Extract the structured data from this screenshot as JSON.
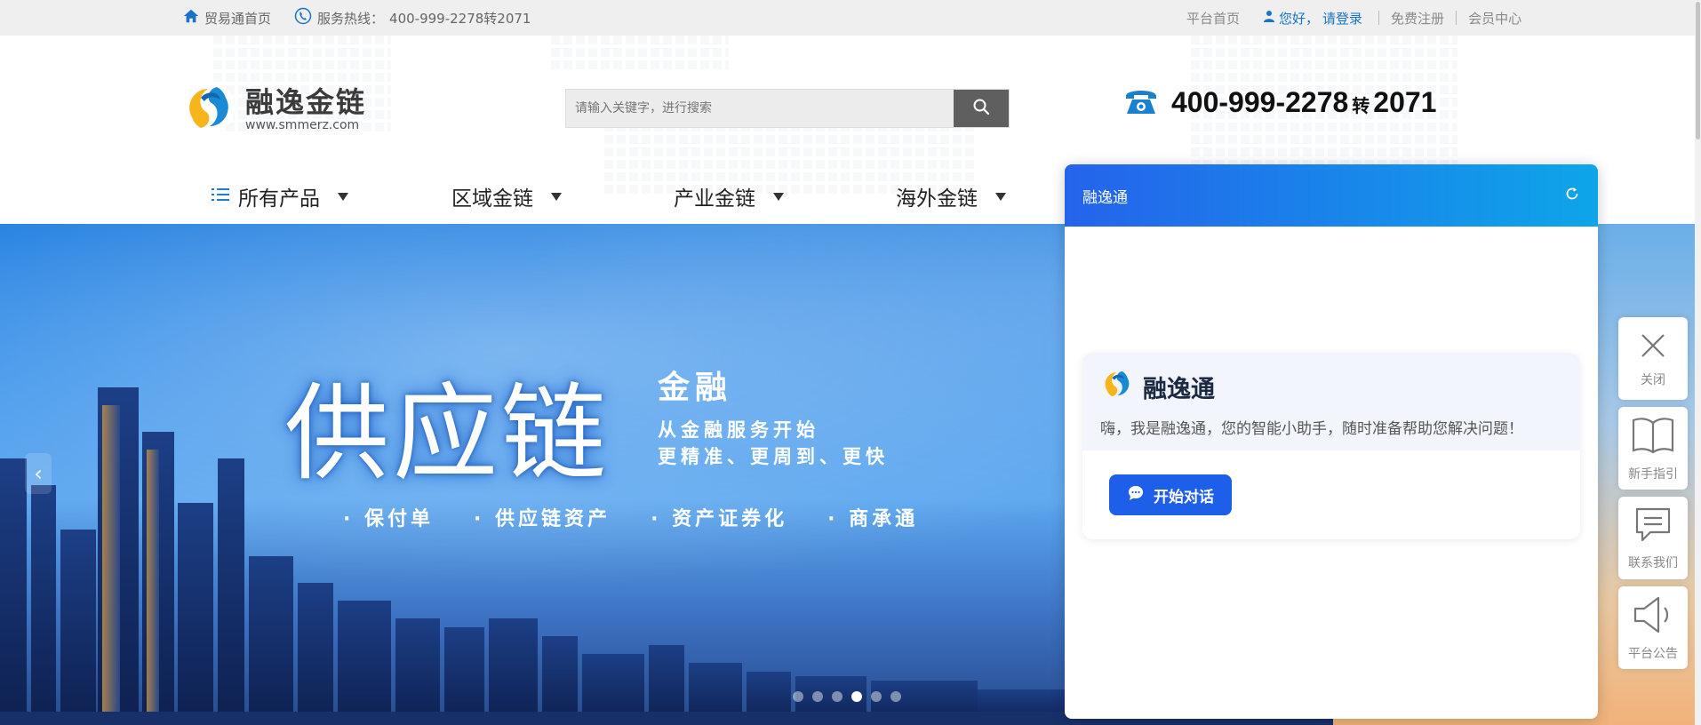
{
  "topbar": {
    "home_label": "贸易通首页",
    "hotline_label": "服务热线：",
    "hotline_number": "400-999-2278转2071",
    "platform_home": "平台首页",
    "greeting": "您好，",
    "login": "请登录",
    "register": "免费注册",
    "member_center": "会员中心"
  },
  "header": {
    "logo_name": "融逸金链",
    "logo_url": "www.smmerz.com",
    "search_placeholder": "请输入关键字，进行搜索",
    "hotline_main": "400-999-2278",
    "hotline_zhuan": "转",
    "hotline_ext": "2071"
  },
  "nav": {
    "items": [
      {
        "label": "所有产品"
      },
      {
        "label": "区域金链"
      },
      {
        "label": "产业金链"
      },
      {
        "label": "海外金链"
      }
    ]
  },
  "banner": {
    "title": "供应链",
    "sub1": "金融",
    "sub2_line1": "从金融服务开始",
    "sub2_line2": "更精准、更周到、更快",
    "tags": [
      "· 保付单",
      "· 供应链资产",
      "· 资产证券化",
      "· 商承通"
    ],
    "prev_icon": "‹",
    "slide_count": 6,
    "active_slide": 4
  },
  "chat": {
    "header_title": "融逸通",
    "card_title": "融逸通",
    "card_message": "嗨，我是融逸通，您的智能小助手，随时准备帮助您解决问题！",
    "start_label": "开始对话"
  },
  "side_toolbar": {
    "close": "关闭",
    "guide": "新手指引",
    "contact": "联系我们",
    "notice": "平台公告"
  },
  "colors": {
    "accent_blue": "#1d5fe8",
    "link_blue": "#1a73c9",
    "topbar_bg": "#efefef"
  },
  "icons": {
    "home": "home-icon",
    "phone": "phone-icon",
    "user": "user-icon",
    "search": "search-icon",
    "telephone": "telephone-icon",
    "list": "list-icon",
    "refresh": "refresh-icon",
    "chat": "chat-bubble-icon",
    "close": "close-icon",
    "book": "book-icon",
    "message": "message-icon",
    "speaker": "speaker-icon"
  }
}
